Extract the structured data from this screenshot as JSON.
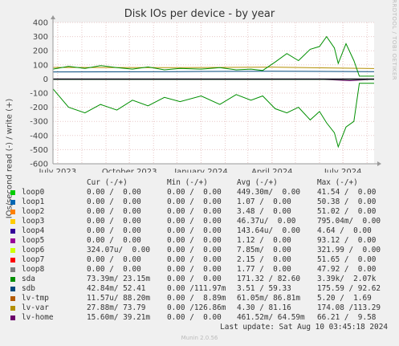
{
  "title": "Disk IOs per device - by year",
  "y_axis_label": "IOs/second read (-) / write (+)",
  "credit": "RRDTOOL / TOBI OETIKER",
  "legend_header": [
    "Cur (-/+)",
    "Min (-/+)",
    "Avg (-/+)",
    "Max (-/+)"
  ],
  "legend": [
    {
      "name": "loop0",
      "color": "#00cc00",
      "cur": "0.00 /  0.00",
      "min": "0.00 /  0.00",
      "avg": "449.30m/  0.00",
      "max": "41.54 /  0.00"
    },
    {
      "name": "loop1",
      "color": "#0066b3",
      "cur": "0.00 /  0.00",
      "min": "0.00 /  0.00",
      "avg": "1.07 /  0.00",
      "max": "50.38 /  0.00"
    },
    {
      "name": "loop2",
      "color": "#ff8000",
      "cur": "0.00 /  0.00",
      "min": "0.00 /  0.00",
      "avg": "3.48 /  0.00",
      "max": "51.02 /  0.00"
    },
    {
      "name": "loop3",
      "color": "#ffcc00",
      "cur": "0.00 /  0.00",
      "min": "0.00 /  0.00",
      "avg": "46.37u/  0.00",
      "max": "795.04m/  0.00"
    },
    {
      "name": "loop4",
      "color": "#330099",
      "cur": "0.00 /  0.00",
      "min": "0.00 /  0.00",
      "avg": "143.64u/  0.00",
      "max": "4.64 /  0.00"
    },
    {
      "name": "loop5",
      "color": "#990099",
      "cur": "0.00 /  0.00",
      "min": "0.00 /  0.00",
      "avg": "1.12 /  0.00",
      "max": "93.12 /  0.00"
    },
    {
      "name": "loop6",
      "color": "#ccff00",
      "cur": "324.07u/  0.00",
      "min": "0.00 /  0.00",
      "avg": "7.85m/  0.00",
      "max": "321.99 /  0.00"
    },
    {
      "name": "loop7",
      "color": "#ff0000",
      "cur": "0.00 /  0.00",
      "min": "0.00 /  0.00",
      "avg": "2.15 /  0.00",
      "max": "51.65 /  0.00"
    },
    {
      "name": "loop8",
      "color": "#808080",
      "cur": "0.00 /  0.00",
      "min": "0.00 /  0.00",
      "avg": "1.77 /  0.00",
      "max": "47.92 /  0.00"
    },
    {
      "name": "sda",
      "color": "#008f00",
      "cur": "73.39m/ 23.15m",
      "min": "0.00 /  0.00",
      "avg": "171.32 / 82.60",
      "max": "3.39k/  2.07k"
    },
    {
      "name": "sdb",
      "color": "#00487d",
      "cur": "42.84m/ 52.41",
      "min": "0.00 /111.97m",
      "avg": "3.51 / 59.33",
      "max": "175.59 / 92.62"
    },
    {
      "name": "lv-tmp",
      "color": "#b35a00",
      "cur": "11.57u/ 88.20m",
      "min": "0.00 /  8.89m",
      "avg": "61.05m/ 86.81m",
      "max": "5.20 /  1.69"
    },
    {
      "name": "lv-var",
      "color": "#b38f00",
      "cur": "27.88m/ 73.79",
      "min": "0.00 /126.86m",
      "avg": "4.30 / 81.16",
      "max": "174.08 /113.29"
    },
    {
      "name": "lv-home",
      "color": "#6b006b",
      "cur": "15.60m/ 39.21m",
      "min": "0.00 /  0.00",
      "avg": "461.52m/ 64.59m",
      "max": "66.21 /  9.58"
    }
  ],
  "last_update": "Last update: Sat Aug 10 03:45:18 2024",
  "munin_version": "Munin 2.0.56",
  "chart_data": {
    "type": "line",
    "title": "Disk IOs per device - by year",
    "ylabel": "IOs/second read (-) / write (+)",
    "ylim": [
      -600,
      400
    ],
    "y_ticks": [
      -600,
      -500,
      -400,
      -300,
      -200,
      -100,
      0,
      100,
      200,
      300,
      400
    ],
    "x_range": [
      "2023-06-25",
      "2024-08-10"
    ],
    "x_ticks": [
      {
        "date": "2023-07-01",
        "label": "July 2023"
      },
      {
        "date": "2023-10-01",
        "label": "October 2023"
      },
      {
        "date": "2024-01-01",
        "label": "January 2024"
      },
      {
        "date": "2024-04-01",
        "label": "April 2024"
      },
      {
        "date": "2024-07-01",
        "label": "July 2024"
      }
    ],
    "grid": true,
    "series": [
      {
        "name": "sda",
        "color": "#008f00",
        "write": [
          [
            "2023-06-25",
            70
          ],
          [
            "2023-07-15",
            90
          ],
          [
            "2023-08-05",
            75
          ],
          [
            "2023-08-25",
            95
          ],
          [
            "2023-09-15",
            80
          ],
          [
            "2023-10-05",
            70
          ],
          [
            "2023-10-25",
            85
          ],
          [
            "2023-11-15",
            65
          ],
          [
            "2023-12-05",
            75
          ],
          [
            "2024-01-01",
            70
          ],
          [
            "2024-01-25",
            80
          ],
          [
            "2024-02-15",
            65
          ],
          [
            "2024-03-05",
            70
          ],
          [
            "2024-03-20",
            60
          ],
          [
            "2024-04-05",
            120
          ],
          [
            "2024-04-20",
            180
          ],
          [
            "2024-05-05",
            130
          ],
          [
            "2024-05-20",
            210
          ],
          [
            "2024-06-01",
            230
          ],
          [
            "2024-06-10",
            300
          ],
          [
            "2024-06-20",
            220
          ],
          [
            "2024-06-25",
            110
          ],
          [
            "2024-07-05",
            250
          ],
          [
            "2024-07-15",
            130
          ],
          [
            "2024-07-22",
            20
          ],
          [
            "2024-08-10",
            20
          ]
        ],
        "read": [
          [
            "2023-06-25",
            -70
          ],
          [
            "2023-07-15",
            -200
          ],
          [
            "2023-08-05",
            -240
          ],
          [
            "2023-08-25",
            -180
          ],
          [
            "2023-09-15",
            -220
          ],
          [
            "2023-10-05",
            -150
          ],
          [
            "2023-10-25",
            -190
          ],
          [
            "2023-11-15",
            -130
          ],
          [
            "2023-12-05",
            -160
          ],
          [
            "2024-01-01",
            -120
          ],
          [
            "2024-01-25",
            -180
          ],
          [
            "2024-02-15",
            -110
          ],
          [
            "2024-03-05",
            -150
          ],
          [
            "2024-03-20",
            -120
          ],
          [
            "2024-04-05",
            -210
          ],
          [
            "2024-04-20",
            -240
          ],
          [
            "2024-05-05",
            -200
          ],
          [
            "2024-05-20",
            -290
          ],
          [
            "2024-06-01",
            -230
          ],
          [
            "2024-06-10",
            -310
          ],
          [
            "2024-06-20",
            -380
          ],
          [
            "2024-06-25",
            -480
          ],
          [
            "2024-07-05",
            -340
          ],
          [
            "2024-07-15",
            -300
          ],
          [
            "2024-07-22",
            -30
          ],
          [
            "2024-08-10",
            -30
          ]
        ]
      },
      {
        "name": "sdb",
        "color": "#00487d",
        "write": [
          [
            "2023-06-25",
            50
          ],
          [
            "2023-12-01",
            52
          ],
          [
            "2024-04-01",
            55
          ],
          [
            "2024-08-10",
            52
          ]
        ],
        "read": [
          [
            "2023-06-25",
            -3
          ],
          [
            "2024-08-10",
            -3
          ]
        ]
      },
      {
        "name": "lv-var",
        "color": "#b38f00",
        "write": [
          [
            "2023-06-25",
            82
          ],
          [
            "2023-12-01",
            80
          ],
          [
            "2024-04-01",
            84
          ],
          [
            "2024-08-10",
            74
          ]
        ],
        "read": [
          [
            "2023-06-25",
            -4
          ],
          [
            "2024-08-10",
            -4
          ]
        ]
      },
      {
        "name": "lv-home",
        "color": "#6b006b",
        "write": [
          [
            "2023-06-25",
            0
          ],
          [
            "2024-08-10",
            0
          ]
        ],
        "read": [
          [
            "2023-06-25",
            -1
          ],
          [
            "2024-06-01",
            -2
          ],
          [
            "2024-07-10",
            -12
          ],
          [
            "2024-08-10",
            -2
          ]
        ]
      }
    ]
  }
}
